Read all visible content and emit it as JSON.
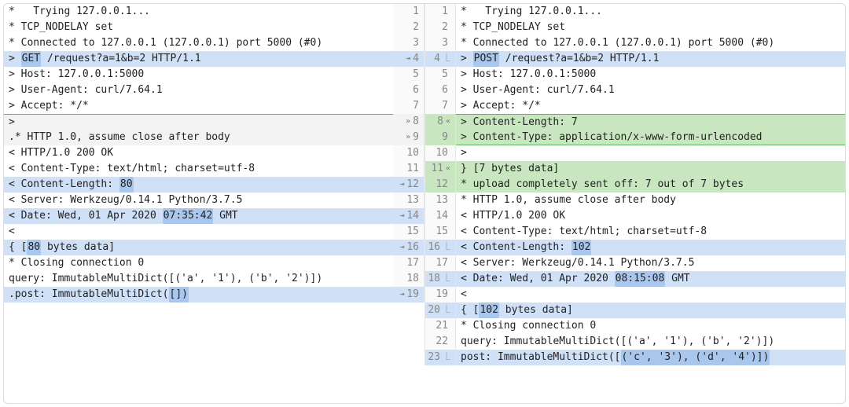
{
  "left": [
    {
      "num": 1,
      "hl": "none",
      "marker": "",
      "text": "*   Trying 127.0.0.1..."
    },
    {
      "num": 2,
      "hl": "none",
      "marker": "",
      "text": "* TCP_NODELAY set"
    },
    {
      "num": 3,
      "hl": "none",
      "marker": "",
      "text": "* Connected to 127.0.0.1 (127.0.0.1) port 5000 (#0)"
    },
    {
      "num": 4,
      "hl": "blue",
      "marker": "⇥",
      "text": "> GET /request?a=1&b=2 HTTP/1.1",
      "wordStart": 2,
      "wordEnd": 5
    },
    {
      "num": 5,
      "hl": "none",
      "marker": "",
      "text": "> Host: 127.0.0.1:5000"
    },
    {
      "num": 6,
      "hl": "none",
      "marker": "",
      "text": "> User-Agent: curl/7.64.1"
    },
    {
      "num": 7,
      "hl": "none",
      "marker": "",
      "text": "> Accept: */*"
    },
    {
      "num": 8,
      "hl": "gray",
      "marker": "»",
      "text": ">",
      "topGreen": true
    },
    {
      "num": 9,
      "hl": "gray",
      "marker": "»",
      "text": "* HTTP 1.0, assume close after body",
      "dot": true
    },
    {
      "num": 10,
      "hl": "none",
      "marker": "",
      "text": "< HTTP/1.0 200 OK"
    },
    {
      "num": 11,
      "hl": "none",
      "marker": "",
      "text": "< Content-Type: text/html; charset=utf-8"
    },
    {
      "num": 12,
      "hl": "blue",
      "marker": "⇥",
      "text": "< Content-Length: 80",
      "wordStart": 18,
      "wordEnd": 20
    },
    {
      "num": 13,
      "hl": "none",
      "marker": "",
      "text": "< Server: Werkzeug/0.14.1 Python/3.7.5"
    },
    {
      "num": 14,
      "hl": "blue",
      "marker": "⇥",
      "text": "< Date: Wed, 01 Apr 2020 07:35:42 GMT",
      "wordStart": 25,
      "wordEnd": 33
    },
    {
      "num": 15,
      "hl": "none",
      "marker": "",
      "text": "<"
    },
    {
      "num": 16,
      "hl": "blue",
      "marker": "⇥",
      "text": "{ [80 bytes data]",
      "wordStart": 3,
      "wordEnd": 5
    },
    {
      "num": 17,
      "hl": "none",
      "marker": "",
      "text": "* Closing connection 0"
    },
    {
      "num": 18,
      "hl": "none",
      "marker": "",
      "text": "query: ImmutableMultiDict([('a', '1'), ('b', '2')])"
    },
    {
      "num": 19,
      "hl": "blue",
      "marker": "⇥",
      "text": "post: ImmutableMultiDict([])",
      "wordStart": 25,
      "wordEnd": 29,
      "dot": true
    }
  ],
  "right": [
    {
      "num": 1,
      "hl": "none",
      "marker": "",
      "text": "*   Trying 127.0.0.1..."
    },
    {
      "num": 2,
      "hl": "none",
      "marker": "",
      "text": "* TCP_NODELAY set"
    },
    {
      "num": 3,
      "hl": "none",
      "marker": "",
      "text": "* Connected to 127.0.0.1 (127.0.0.1) port 5000 (#0)"
    },
    {
      "num": 4,
      "hl": "blue",
      "marker": "⎿",
      "text": "> POST /request?a=1&b=2 HTTP/1.1",
      "wordStart": 2,
      "wordEnd": 6
    },
    {
      "num": 5,
      "hl": "none",
      "marker": "",
      "text": "> Host: 127.0.0.1:5000"
    },
    {
      "num": 6,
      "hl": "none",
      "marker": "",
      "text": "> User-Agent: curl/7.64.1"
    },
    {
      "num": 7,
      "hl": "none",
      "marker": "",
      "text": "> Accept: */*"
    },
    {
      "num": 8,
      "hl": "green",
      "marker": "«",
      "text": "> Content-Length: 7",
      "topGreen": true
    },
    {
      "num": 9,
      "hl": "green",
      "marker": "",
      "text": "> Content-Type: application/x-www-form-urlencoded",
      "botGreen": true
    },
    {
      "num": 10,
      "hl": "none",
      "marker": "",
      "text": ">"
    },
    {
      "num": 11,
      "hl": "green",
      "marker": "«",
      "text": "} [7 bytes data]"
    },
    {
      "num": 12,
      "hl": "green",
      "marker": "",
      "text": "* upload completely sent off: 7 out of 7 bytes"
    },
    {
      "num": 13,
      "hl": "none",
      "marker": "",
      "text": "* HTTP 1.0, assume close after body"
    },
    {
      "num": 14,
      "hl": "none",
      "marker": "",
      "text": "< HTTP/1.0 200 OK"
    },
    {
      "num": 15,
      "hl": "none",
      "marker": "",
      "text": "< Content-Type: text/html; charset=utf-8"
    },
    {
      "num": 16,
      "hl": "blue",
      "marker": "⎿",
      "text": "< Content-Length: 102",
      "wordStart": 18,
      "wordEnd": 21
    },
    {
      "num": 17,
      "hl": "none",
      "marker": "",
      "text": "< Server: Werkzeug/0.14.1 Python/3.7.5"
    },
    {
      "num": 18,
      "hl": "blue",
      "marker": "⎿",
      "text": "< Date: Wed, 01 Apr 2020 08:15:08 GMT",
      "wordStart": 25,
      "wordEnd": 33
    },
    {
      "num": 19,
      "hl": "none",
      "marker": "",
      "text": "<"
    },
    {
      "num": 20,
      "hl": "blue",
      "marker": "⎿",
      "text": "{ [102 bytes data]",
      "wordStart": 3,
      "wordEnd": 6
    },
    {
      "num": 21,
      "hl": "none",
      "marker": "",
      "text": "* Closing connection 0"
    },
    {
      "num": 22,
      "hl": "none",
      "marker": "",
      "text": "query: ImmutableMultiDict([('a', '1'), ('b', '2')])"
    },
    {
      "num": 23,
      "hl": "blue",
      "marker": "⎿",
      "text": "post: ImmutableMultiDict([('c', '3'), ('d', '4')])",
      "wordStart": 26,
      "wordEnd": 50
    }
  ]
}
